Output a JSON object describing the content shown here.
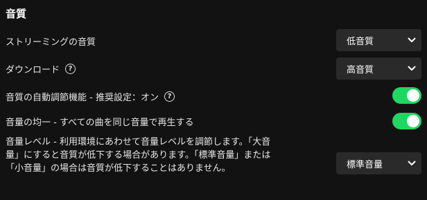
{
  "section": {
    "title": "音質"
  },
  "streaming": {
    "label": "ストリーミングの音質",
    "value": "低音質"
  },
  "download": {
    "label": "ダウンロード",
    "value": "高音質",
    "help_glyph": "?"
  },
  "auto_adjust": {
    "label": "音質の自動調節機能 - 推奨設定：オン",
    "enabled": true,
    "help_glyph": "?"
  },
  "normalize": {
    "label": "音量の均一 - すべての曲を同じ音量で再生する",
    "enabled": true
  },
  "volume_level": {
    "description": "音量レベル - 利用環境にあわせて音量レベルを調節します。「大音量」にすると音質が低下する場合があります。「標準音量」または「小音量」の場合は音質が低下することはありません。",
    "value": "標準音量"
  },
  "colors": {
    "background": "#121212",
    "select_bg": "#2a2a2a",
    "toggle_on": "#1ed760",
    "text": "#ffffff"
  },
  "icons": {
    "help": "help-circle-icon",
    "dropdown": "chevron-down-icon"
  }
}
